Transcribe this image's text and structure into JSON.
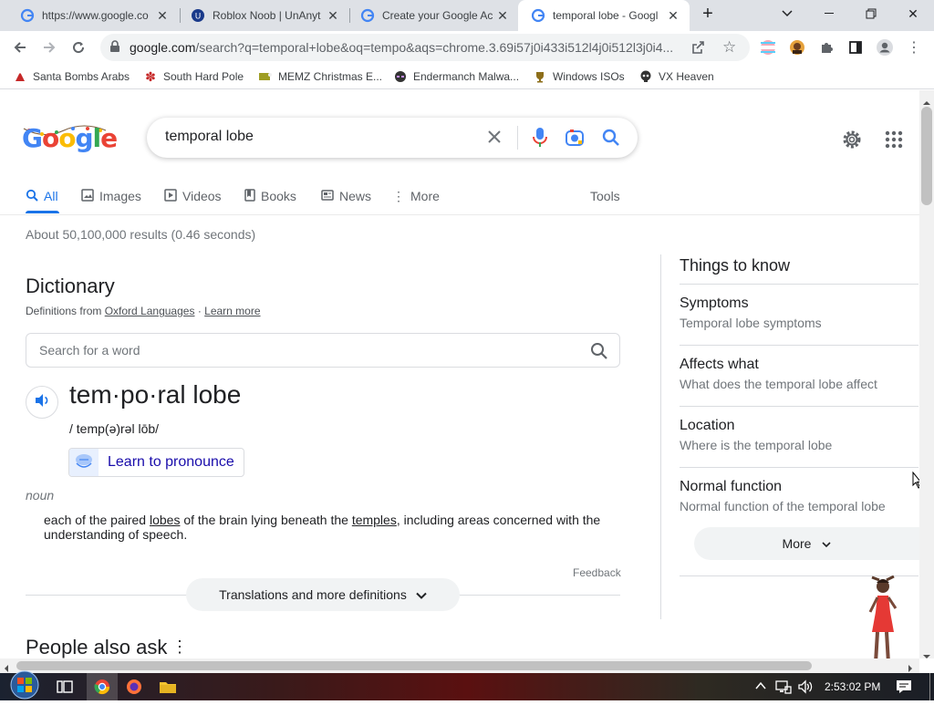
{
  "tabs": [
    {
      "title": "https://www.google.co",
      "favicon": "google-g-icon"
    },
    {
      "title": "Roblox Noob | UnAnyt",
      "favicon": "unanything-icon"
    },
    {
      "title": "Create your Google Ac",
      "favicon": "google-g-icon"
    },
    {
      "title": "temporal lobe - Googl",
      "favicon": "google-g-icon",
      "active": true
    }
  ],
  "toolbar": {
    "url_host": "google.com",
    "url_rest": "/search?q=temporal+lobe&oq=tempo&aqs=chrome.3.69i57j0i433i512l4j0i512l3j0i4..."
  },
  "bookmarks": [
    "Santa Bombs Arabs",
    "South Hard Pole",
    "MEMZ Christmas E...",
    "Endermanch Malwa...",
    "Windows ISOs",
    "VX Heaven"
  ],
  "search": {
    "logo": "Google",
    "query": "temporal lobe"
  },
  "nav_tabs": [
    {
      "label": "All",
      "icon": "search-icon",
      "active": true
    },
    {
      "label": "Images",
      "icon": "image-icon"
    },
    {
      "label": "Videos",
      "icon": "play-icon"
    },
    {
      "label": "Books",
      "icon": "book-icon"
    },
    {
      "label": "News",
      "icon": "news-icon"
    },
    {
      "label": "More",
      "icon": "more-vert-icon"
    }
  ],
  "tools_label": "Tools",
  "result_stats": "About 50,100,000 results (0.46 seconds)",
  "dictionary": {
    "heading": "Dictionary",
    "definitions_from": "Definitions from",
    "source": "Oxford Languages",
    "sep": "·",
    "learn_more": "Learn more",
    "search_placeholder": "Search for a word",
    "word": "tem·po·ral lobe",
    "phonetic": "/ temp(ə)rəl lōb/",
    "pronounce_label": "Learn to pronounce",
    "pos": "noun",
    "def_1": "each of the paired ",
    "def_link1": "lobes",
    "def_2": " of the brain lying beneath the ",
    "def_link2": "temples",
    "def_3": ", including areas concerned with the understanding of speech.",
    "feedback": "Feedback",
    "translations": "Translations and more definitions"
  },
  "people_also_ask": "People also ask",
  "things_to_know": {
    "heading": "Things to know",
    "items": [
      {
        "title": "Symptoms",
        "subtitle": "Temporal lobe symptoms"
      },
      {
        "title": "Affects what",
        "subtitle": "What does the temporal lobe affect"
      },
      {
        "title": "Location",
        "subtitle": "Where is the temporal lobe"
      },
      {
        "title": "Normal function",
        "subtitle": "Normal function of the temporal lobe"
      }
    ],
    "more_label": "More"
  },
  "taskbar": {
    "time": "2:53:02 PM"
  },
  "colors": {
    "link_blue": "#1a0dab",
    "google_blue": "#4285f4",
    "google_red": "#ea4335",
    "google_yellow": "#fbbc05",
    "google_green": "#34a853",
    "tab_strip": "#dee1e6"
  }
}
